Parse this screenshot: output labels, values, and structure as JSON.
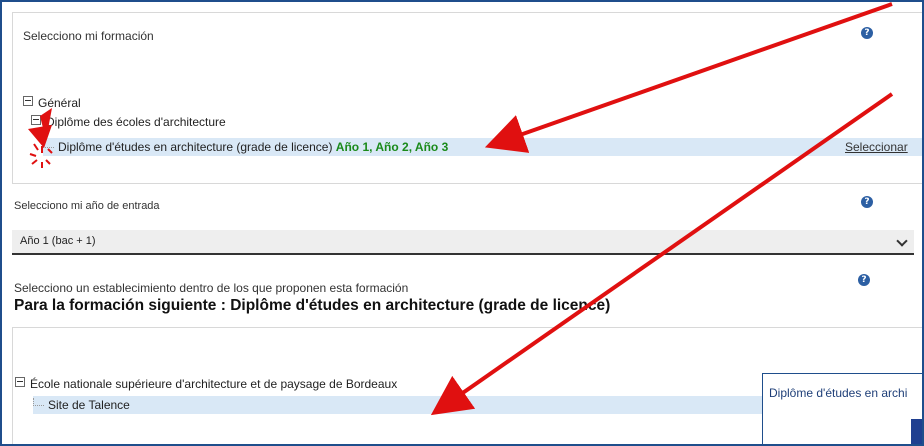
{
  "section1": {
    "title": "Selecciono mi formación",
    "tree": {
      "root": "Général",
      "child": "Diplôme des écoles d'architecture",
      "leaf": "Diplôme d'études en architecture (grade de licence)",
      "leaf_years": "Año 1, Año 2, Año 3"
    },
    "select_link": "Seleccionar"
  },
  "section2": {
    "title": "Selecciono mi año de entrada",
    "selected": "Año 1 (bac + 1)"
  },
  "section3": {
    "title": "Selecciono un establecimiento dentro de los que proponen esta formación",
    "heading": "Para la formación siguiente : Diplôme d'études en architecture (grade de licence)",
    "tree": {
      "root": "École nationale supérieure d'architecture et de paysage de Bordeaux",
      "leaf": "Site de Talence"
    }
  },
  "popup": {
    "text": "Diplôme d'études en archi"
  },
  "colors": {
    "accent": "#1f4e8c",
    "highlight": "#d9e8f6",
    "green": "#1a8a1a",
    "arrow": "#e01010"
  },
  "icons": [
    "help-icon",
    "collapse-icon",
    "red-arrow",
    "click-burst-icon",
    "chevron-down-icon"
  ]
}
